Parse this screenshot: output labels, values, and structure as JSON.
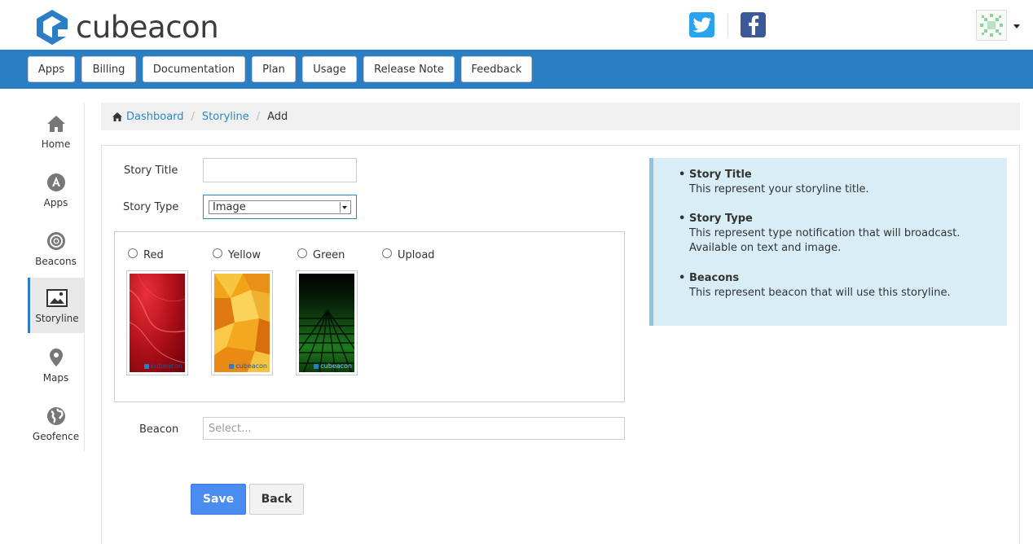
{
  "brand": {
    "name": "cubeacon"
  },
  "nav": [
    "Apps",
    "Billing",
    "Documentation",
    "Plan",
    "Usage",
    "Release Note",
    "Feedback"
  ],
  "sidebar": [
    {
      "label": "Home",
      "icon": "home-icon"
    },
    {
      "label": "Apps",
      "icon": "apps-icon"
    },
    {
      "label": "Beacons",
      "icon": "beacon-icon"
    },
    {
      "label": "Storyline",
      "icon": "image-icon",
      "active": true
    },
    {
      "label": "Maps",
      "icon": "map-pin-icon"
    },
    {
      "label": "Geofence",
      "icon": "globe-icon"
    }
  ],
  "breadcrumb": {
    "home": "Dashboard",
    "section": "Storyline",
    "current": "Add"
  },
  "form": {
    "title_label": "Story Title",
    "title_value": "",
    "type_label": "Story Type",
    "type_value": "Image",
    "radio_options": [
      "Red",
      "Yellow",
      "Green",
      "Upload"
    ],
    "thumb_brand": "cubeacon",
    "beacon_label": "Beacon",
    "beacon_placeholder": "Select...",
    "save_label": "Save",
    "back_label": "Back"
  },
  "info": [
    {
      "title": "Story Title",
      "desc": "This represent your storyline title."
    },
    {
      "title": "Story Type",
      "desc": "This represent type notification that will broadcast. Available on text and image."
    },
    {
      "title": "Beacons",
      "desc": "This represent beacon that will use this storyline."
    }
  ],
  "colors": {
    "accent": "#2b7dc4",
    "save": "#4a8cf0",
    "info_bg": "#d9edf7",
    "link": "#2a88c9"
  }
}
